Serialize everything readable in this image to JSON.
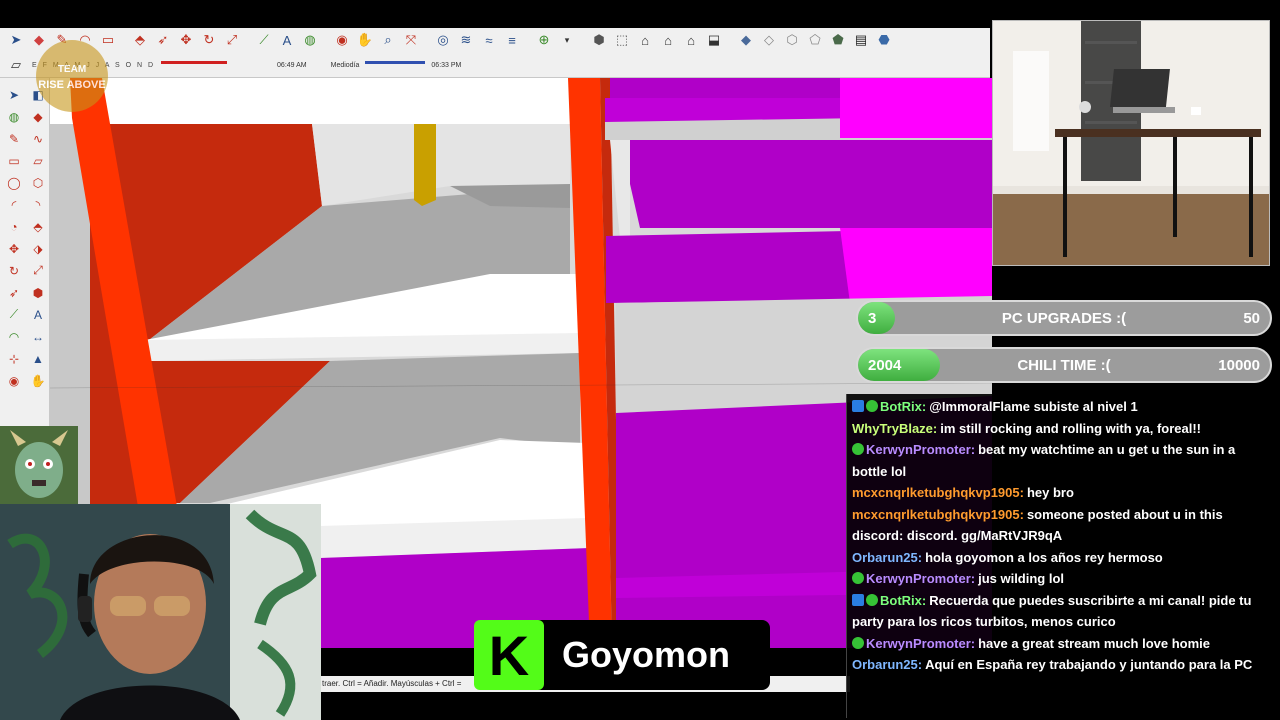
{
  "toolbar": {
    "months": "E F M A M J J A S O N D",
    "time_start": "06:49 AM",
    "time_mid": "Mediodía",
    "time_end": "06:33 PM"
  },
  "team_logo_text": "TEAM RISE ABOVE",
  "status_bar": "traer. Ctrl = Añadir. Mayúsculas + Ctrl =",
  "goals": [
    {
      "current": "3",
      "title": "PC UPGRADES :(",
      "target": "50",
      "progress": 0.06
    },
    {
      "current": "2004",
      "title": "CHILI TIME :(",
      "target": "10000",
      "progress": 0.2
    }
  ],
  "chat": [
    {
      "user": "BotRix:",
      "color": "#7dff7d",
      "badges": [
        "bot",
        "sub"
      ],
      "text": "@ImmoralFlame subiste al nivel 1"
    },
    {
      "user": "WhyTryBlaze:",
      "color": "#c9ff7a",
      "badges": [],
      "text": "im still rocking and rolling with ya, foreal!!"
    },
    {
      "user": "KerwynPromoter:",
      "color": "#b98cff",
      "badges": [
        "sub"
      ],
      "text": "beat my watchtime an u get u the sun in a bottle lol"
    },
    {
      "user": "mcxcnqrlketubghqkvp1905:",
      "color": "#ff9b2e",
      "badges": [],
      "text": "hey bro"
    },
    {
      "user": "mcxcnqrlketubghqkvp1905:",
      "color": "#ff9b2e",
      "badges": [],
      "text": "someone posted about u in this discord: discord. gg/MaRtVJR9qA"
    },
    {
      "user": "Orbarun25:",
      "color": "#7fb7ff",
      "badges": [],
      "text": "hola goyomon a los años rey hermoso"
    },
    {
      "user": "KerwynPromoter:",
      "color": "#b98cff",
      "badges": [
        "sub"
      ],
      "text": "jus wilding lol"
    },
    {
      "user": "BotRix:",
      "color": "#7dff7d",
      "badges": [
        "bot",
        "sub"
      ],
      "text": "Recuerda que puedes suscribirte a mi canal! pide tu party para los ricos turbitos, menos curico"
    },
    {
      "user": "KerwynPromoter:",
      "color": "#b98cff",
      "badges": [
        "sub"
      ],
      "text": "have a great stream much love homie"
    },
    {
      "user": "Orbarun25:",
      "color": "#7fb7ff",
      "badges": [],
      "text": "Aquí en España rey trabajando y juntando para la PC"
    }
  ],
  "kick": {
    "logo_letter": "K",
    "streamer_name": "Goyomon"
  },
  "colors": {
    "magenta": "#b000c8",
    "bright_magenta": "#ff00ff",
    "red_frame": "#ff3300",
    "dark_red": "#c52a0d",
    "kick_green": "#53fc18"
  }
}
